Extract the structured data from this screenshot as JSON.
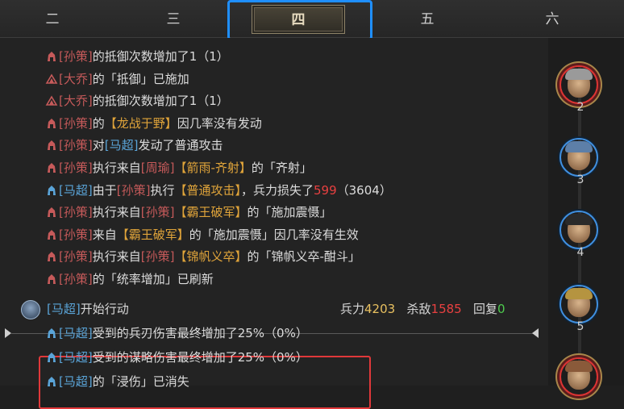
{
  "tabs": [
    "二",
    "三",
    "四",
    "五",
    "六"
  ],
  "active_tab": "四",
  "log": {
    "lines": [
      {
        "seg": [
          [
            "red",
            "[孙策]"
          ],
          [
            "txt",
            "的抵御次数增加了1（1）"
          ]
        ],
        "icon": "red-hat-icon"
      },
      {
        "seg": [
          [
            "red",
            "[大乔]"
          ],
          [
            "txt",
            "的「抵御」已施加"
          ]
        ],
        "icon": "red-fan-icon"
      },
      {
        "seg": [
          [
            "red",
            "[大乔]"
          ],
          [
            "txt",
            "的抵御次数增加了1（1）"
          ]
        ],
        "icon": "red-fan-icon"
      },
      {
        "seg": [
          [
            "red",
            "[孙策]"
          ],
          [
            "txt",
            "的"
          ],
          [
            "gold",
            "【龙战于野】"
          ],
          [
            "txt",
            "因几率没有发动"
          ]
        ],
        "icon": "red-hat-icon"
      },
      {
        "seg": [
          [
            "red",
            "[孙策]"
          ],
          [
            "txt",
            "对"
          ],
          [
            "blue",
            "[马超]"
          ],
          [
            "txt",
            "发动了普通攻击"
          ]
        ],
        "icon": "red-hat-icon"
      },
      {
        "seg": [
          [
            "red",
            "[孙策]"
          ],
          [
            "txt",
            "执行来自"
          ],
          [
            "red",
            "[周瑜]"
          ],
          [
            "gold",
            "【箭雨-齐射】"
          ],
          [
            "txt",
            "的「齐射」"
          ]
        ],
        "icon": "red-hat-icon"
      },
      {
        "seg": [
          [
            "blue",
            "[马超]"
          ],
          [
            "txt",
            "由于"
          ],
          [
            "red",
            "[孙策]"
          ],
          [
            "txt",
            "执行"
          ],
          [
            "gold",
            "【普通攻击】"
          ],
          [
            "txt",
            "，兵力损失了"
          ],
          [
            "num",
            "599"
          ],
          [
            "txt",
            "（3604）"
          ]
        ],
        "icon": "blue-hat-icon"
      },
      {
        "seg": [
          [
            "red",
            "[孙策]"
          ],
          [
            "txt",
            "执行来自"
          ],
          [
            "red",
            "[孙策]"
          ],
          [
            "gold",
            "【霸王破军】"
          ],
          [
            "txt",
            "的「施加震慑」"
          ]
        ],
        "icon": "red-hat-icon"
      },
      {
        "seg": [
          [
            "red",
            "[孙策]"
          ],
          [
            "txt",
            "来自"
          ],
          [
            "gold",
            "【霸王破军】"
          ],
          [
            "txt",
            "的「施加震慑」因几率没有生效"
          ]
        ],
        "icon": "red-hat-icon"
      },
      {
        "seg": [
          [
            "red",
            "[孙策]"
          ],
          [
            "txt",
            "执行来自"
          ],
          [
            "red",
            "[孙策]"
          ],
          [
            "gold",
            "【锦帆义卒】"
          ],
          [
            "txt",
            "的「锦帆义卒-酣斗」"
          ]
        ],
        "icon": "red-hat-icon"
      },
      {
        "seg": [
          [
            "red",
            "[孙策]"
          ],
          [
            "txt",
            "的「统率增加」已刷新"
          ]
        ],
        "icon": "red-hat-icon"
      }
    ],
    "actor": {
      "name": "[马超]",
      "action": "开始行动",
      "troops_label": "兵力",
      "troops": "4203",
      "kills_label": "杀敌",
      "kills": "1585",
      "heal_label": "回复",
      "heal": "0"
    },
    "after": [
      {
        "seg": [
          [
            "blue",
            "[马超]"
          ],
          [
            "txt",
            "受到的兵刃伤害最终增加了25%（0%）"
          ]
        ],
        "icon": "blue-hat-icon"
      },
      {
        "seg": [
          [
            "blue",
            "[马超]"
          ],
          [
            "txt",
            "受到的谋略伤害最终增加了25%（0%）"
          ]
        ],
        "icon": "blue-hat-icon"
      },
      {
        "seg": [
          [
            "blue",
            "[马超]"
          ],
          [
            "txt",
            "的「浸伤」已消失"
          ]
        ],
        "icon": "blue-hat-icon"
      }
    ]
  },
  "turn_order": [
    {
      "num": "2",
      "ring": "red",
      "helm": "#9a9a9a"
    },
    {
      "num": "3",
      "ring": "blue",
      "helm": "#5d7fa8"
    },
    {
      "num": "4",
      "ring": "blue",
      "helm": "#2a2a2a"
    },
    {
      "num": "5",
      "ring": "blue",
      "helm": "#b59440"
    },
    {
      "num": "",
      "ring": "red",
      "helm": "#8a5a3a"
    }
  ],
  "colors": {
    "camp_red": "#c65a5a",
    "camp_blue": "#5aa4d8",
    "skill_gold": "#e0a43a",
    "damage": "#e84040",
    "heal": "#4ecb4e",
    "highlight_tab": "#1f8fff",
    "highlight_box": "#e0383a"
  }
}
